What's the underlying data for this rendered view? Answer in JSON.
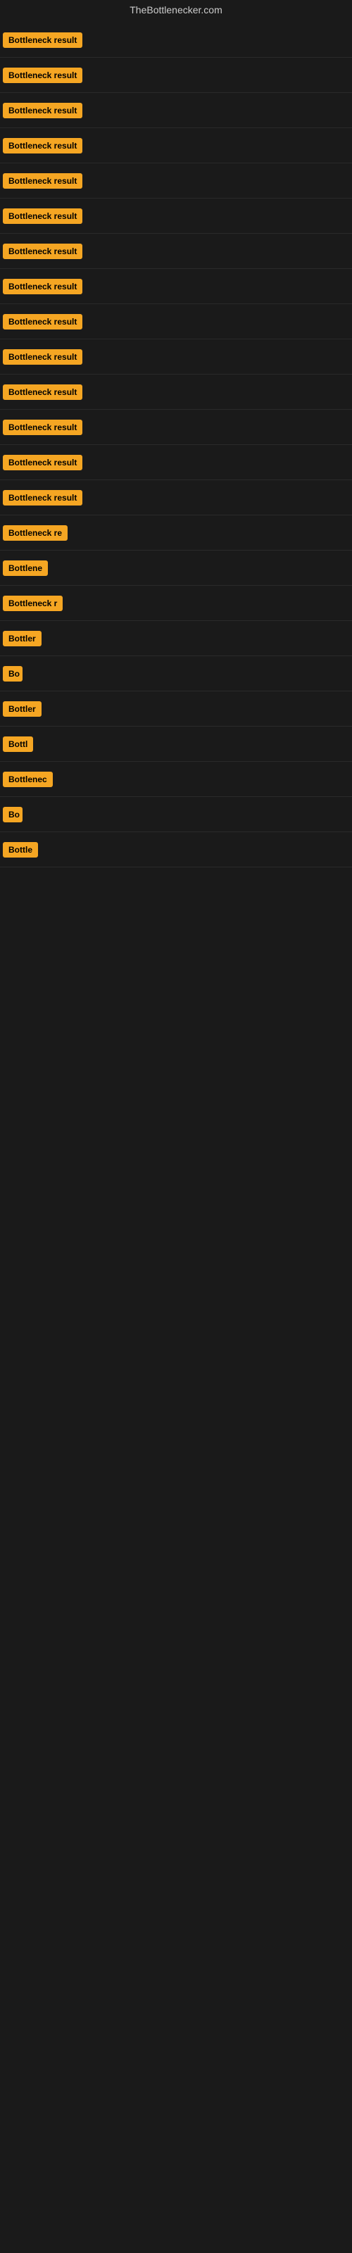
{
  "site": {
    "title": "TheBottlenecker.com"
  },
  "rows": [
    {
      "id": 1,
      "label": "Bottleneck result",
      "width": 120
    },
    {
      "id": 2,
      "label": "Bottleneck result",
      "width": 120
    },
    {
      "id": 3,
      "label": "Bottleneck result",
      "width": 120
    },
    {
      "id": 4,
      "label": "Bottleneck result",
      "width": 120
    },
    {
      "id": 5,
      "label": "Bottleneck result",
      "width": 120
    },
    {
      "id": 6,
      "label": "Bottleneck result",
      "width": 120
    },
    {
      "id": 7,
      "label": "Bottleneck result",
      "width": 120
    },
    {
      "id": 8,
      "label": "Bottleneck result",
      "width": 120
    },
    {
      "id": 9,
      "label": "Bottleneck result",
      "width": 120
    },
    {
      "id": 10,
      "label": "Bottleneck result",
      "width": 120
    },
    {
      "id": 11,
      "label": "Bottleneck result",
      "width": 120
    },
    {
      "id": 12,
      "label": "Bottleneck result",
      "width": 120
    },
    {
      "id": 13,
      "label": "Bottleneck result",
      "width": 120
    },
    {
      "id": 14,
      "label": "Bottleneck result",
      "width": 120
    },
    {
      "id": 15,
      "label": "Bottleneck re",
      "width": 95
    },
    {
      "id": 16,
      "label": "Bottlene",
      "width": 72
    },
    {
      "id": 17,
      "label": "Bottleneck r",
      "width": 88
    },
    {
      "id": 18,
      "label": "Bottler",
      "width": 58
    },
    {
      "id": 19,
      "label": "Bo",
      "width": 28
    },
    {
      "id": 20,
      "label": "Bottler",
      "width": 58
    },
    {
      "id": 21,
      "label": "Bottl",
      "width": 48
    },
    {
      "id": 22,
      "label": "Bottlenec",
      "width": 76
    },
    {
      "id": 23,
      "label": "Bo",
      "width": 28
    },
    {
      "id": 24,
      "label": "Bottle",
      "width": 52
    }
  ],
  "colors": {
    "badge_bg": "#f5a623",
    "badge_text": "#000000",
    "bg": "#1a1a1a",
    "title_text": "#cccccc"
  }
}
